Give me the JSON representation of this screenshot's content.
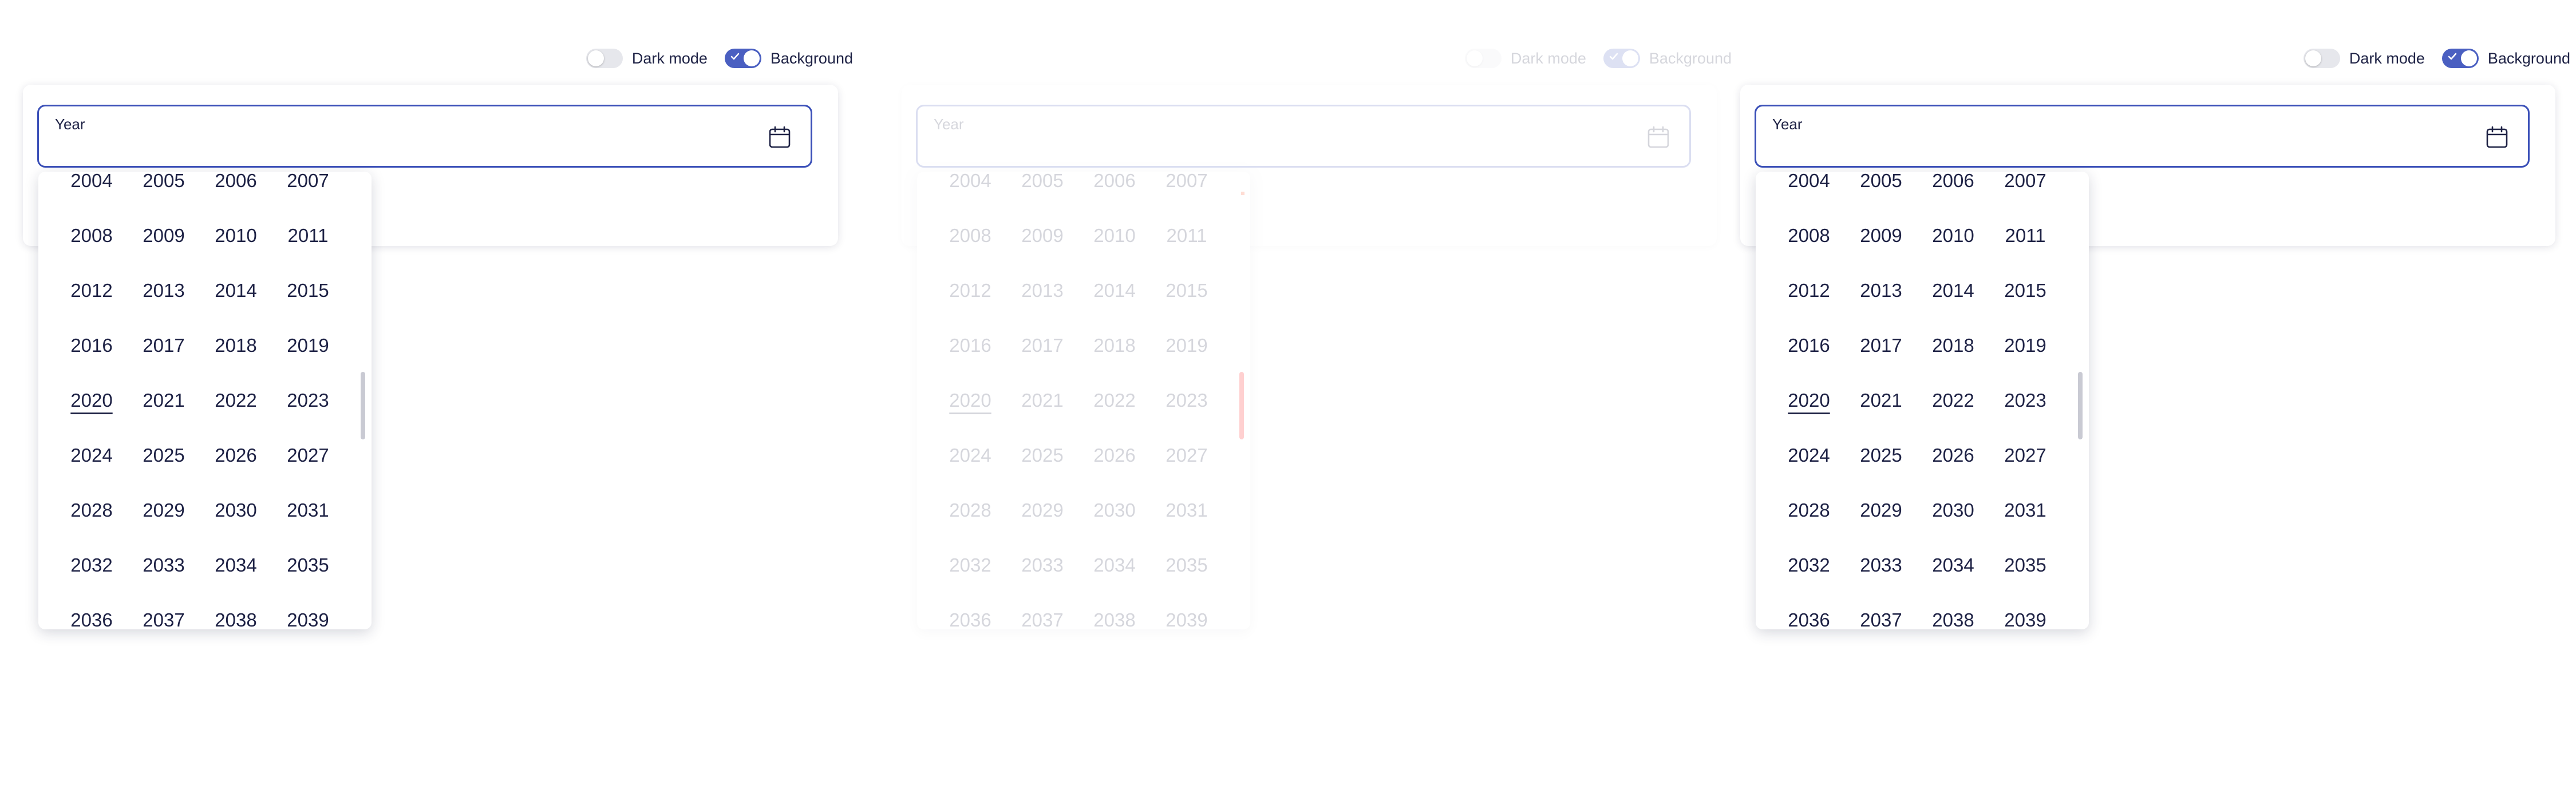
{
  "toggles": {
    "dark_mode_label": "Dark mode",
    "background_label": "Background",
    "dark_mode_on": false,
    "background_on": true
  },
  "field": {
    "label": "Year",
    "icon": "calendar-icon"
  },
  "year_picker": {
    "current_year": "2020",
    "rows": [
      [
        "2004",
        "2005",
        "2006",
        "2007"
      ],
      [
        "2008",
        "2009",
        "2010",
        "2011"
      ],
      [
        "2012",
        "2013",
        "2014",
        "2015"
      ],
      [
        "2016",
        "2017",
        "2018",
        "2019"
      ],
      [
        "2020",
        "2021",
        "2022",
        "2023"
      ],
      [
        "2024",
        "2025",
        "2026",
        "2027"
      ],
      [
        "2028",
        "2029",
        "2030",
        "2031"
      ],
      [
        "2032",
        "2033",
        "2034",
        "2035"
      ],
      [
        "2036",
        "2037",
        "2038",
        "2039"
      ]
    ]
  },
  "colors": {
    "accent": "#3b50b8",
    "text": "#1e2245",
    "scrollbar_highlight": "#ff0000"
  }
}
